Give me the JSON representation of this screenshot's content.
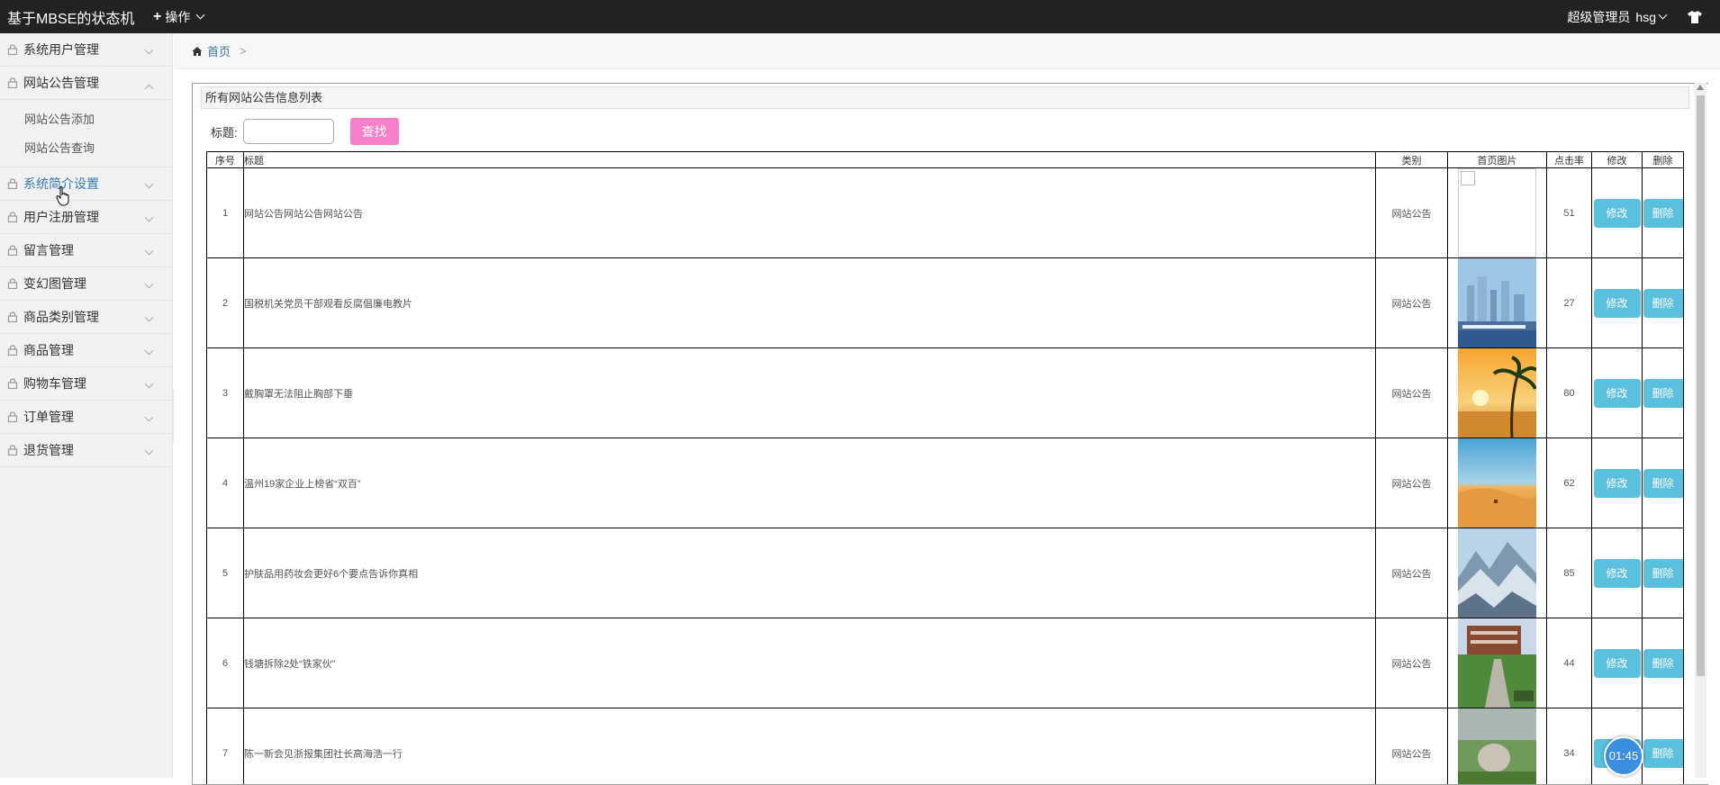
{
  "app": {
    "title": "基于MBSE的状态机",
    "ops_label": "操作"
  },
  "user": {
    "role": "超级管理员",
    "name": "hsg"
  },
  "sidebar": {
    "items": [
      {
        "label": "系统用户管理",
        "expanded": false
      },
      {
        "label": "网站公告管理",
        "expanded": true,
        "children": [
          "网站公告添加",
          "网站公告查询"
        ]
      },
      {
        "label": "系统简介设置",
        "expanded": false
      },
      {
        "label": "用户注册管理",
        "expanded": false
      },
      {
        "label": "留言管理",
        "expanded": false
      },
      {
        "label": "变幻图管理",
        "expanded": false
      },
      {
        "label": "商品类别管理",
        "expanded": false
      },
      {
        "label": "商品管理",
        "expanded": false
      },
      {
        "label": "购物车管理",
        "expanded": false
      },
      {
        "label": "订单管理",
        "expanded": false
      },
      {
        "label": "退货管理",
        "expanded": false
      }
    ]
  },
  "breadcrumb": {
    "home": "首页",
    "separator": ">"
  },
  "panel": {
    "title": "所有网站公告信息列表"
  },
  "search": {
    "label": "标题:",
    "value": "",
    "button": "查找"
  },
  "table": {
    "headers": [
      "序号",
      "标题",
      "类别",
      "首页图片",
      "点击率",
      "修改",
      "删除"
    ],
    "edit_label": "修改",
    "delete_label": "删除",
    "rows": [
      {
        "index": "1",
        "title": "网站公告网站公告网站公告",
        "category": "网站公告",
        "image": "broken",
        "clicks": "51"
      },
      {
        "index": "2",
        "title": "国税机关党员干部观看反腐倡廉电教片",
        "category": "网站公告",
        "image": "city",
        "clicks": "27"
      },
      {
        "index": "3",
        "title": "戴胸罩无法阻止胸部下垂",
        "category": "网站公告",
        "image": "beach",
        "clicks": "80"
      },
      {
        "index": "4",
        "title": "温州19家企业上榜省“双百”",
        "category": "网站公告",
        "image": "desert",
        "clicks": "62"
      },
      {
        "index": "5",
        "title": "护肤品用药妆会更好6个要点告诉你真相",
        "category": "网站公告",
        "image": "mountain",
        "clicks": "85"
      },
      {
        "index": "6",
        "title": "钱塘拆除2处“铁家伙”",
        "category": "网站公告",
        "image": "campus",
        "clicks": "44"
      },
      {
        "index": "7",
        "title": "陈一新会见浙报集团社长高海浩一行",
        "category": "网站公告",
        "image": "garden",
        "clicks": "34"
      }
    ]
  },
  "timer": "01:45",
  "colors": {
    "topbar": "#222222",
    "link": "#337ab7",
    "button": "#5bc0de",
    "search_button": "#f780c8"
  }
}
